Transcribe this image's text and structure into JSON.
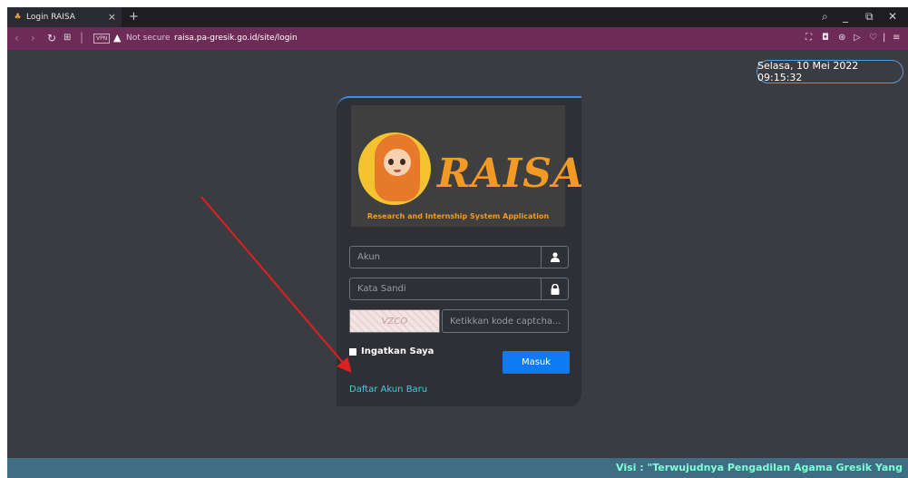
{
  "browser": {
    "tab_title": "Login RAISA",
    "tab_close": "×",
    "new_tab": "+",
    "url_warning": "Not secure",
    "url": "raisa.pa-gresik.go.id/site/login",
    "vpn_badge": "VPN"
  },
  "page": {
    "datetime": "Selasa, 10 Mei 2022 09:15:32",
    "logo": {
      "title": "RAISA",
      "subtitle": "Research and Internship System Application"
    },
    "form": {
      "username_placeholder": "Akun",
      "password_placeholder": "Kata Sandi",
      "captcha_code": "VZCO",
      "captcha_placeholder": "Ketikkan kode captcha...",
      "remember_label": "Ingatkan Saya",
      "submit_label": "Masuk",
      "register_link": "Daftar Akun Baru"
    },
    "footer_marquee": "Visi : \"Terwujudnya Pengadilan Agama Gresik Yang"
  },
  "colors": {
    "accent_blue": "#0d7cf2",
    "logo_orange": "#f29a24",
    "address_bar": "#6d2c58",
    "link_cyan": "#3fd0e0",
    "annotation_arrow": "#e02020"
  }
}
